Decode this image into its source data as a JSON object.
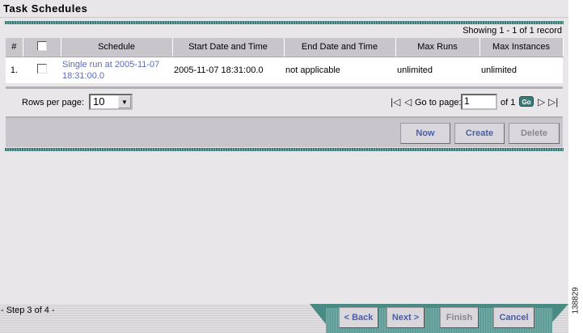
{
  "page": {
    "title": "Task Schedules",
    "side_number": "138829"
  },
  "records": {
    "showing": "Showing 1 - 1 of 1 record"
  },
  "table": {
    "headers": [
      "#",
      "",
      "Schedule",
      "Start Date and Time",
      "End Date and Time",
      "Max Runs",
      "Max Instances"
    ],
    "rows": [
      {
        "num": "1.",
        "schedule_line1": "Single run at 2005-11-07",
        "schedule_line2": "18:31:00.0",
        "start": "2005-11-07 18:31:00.0",
        "end": "not applicable",
        "max_runs": "unlimited",
        "max_instances": "unlimited"
      }
    ]
  },
  "pager": {
    "rows_label": "Rows per page:",
    "rows_value": "10",
    "goto_label": "Go to page:",
    "page_value": "1",
    "of_label": "of 1",
    "go_label": "Go"
  },
  "actions": {
    "now": "Now",
    "create": "Create",
    "delete": "Delete"
  },
  "wizard": {
    "step": "- Step 3 of 4 -",
    "back": "< Back",
    "next": "Next >",
    "finish": "Finish",
    "cancel": "Cancel"
  },
  "colors": {
    "accent": "#3c7c78",
    "link": "#5a6bb3"
  }
}
